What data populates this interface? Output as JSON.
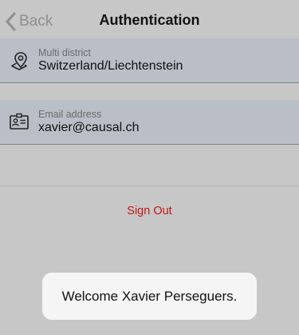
{
  "navbar": {
    "back_label": "Back",
    "title": "Authentication"
  },
  "district_field": {
    "label": "Multi district",
    "value": "Switzerland/Liechtenstein",
    "icon": "location-pin-icon"
  },
  "email_field": {
    "label": "Email address",
    "value": "xavier@causal.ch",
    "icon": "id-card-icon"
  },
  "sign_out_label": "Sign Out",
  "toast_message": "Welcome Xavier Perseguers.",
  "colors": {
    "background": "#c7c7c7",
    "field_background": "#b9bec7",
    "sign_out": "#c41818",
    "toast_background": "#f5f5f5"
  }
}
